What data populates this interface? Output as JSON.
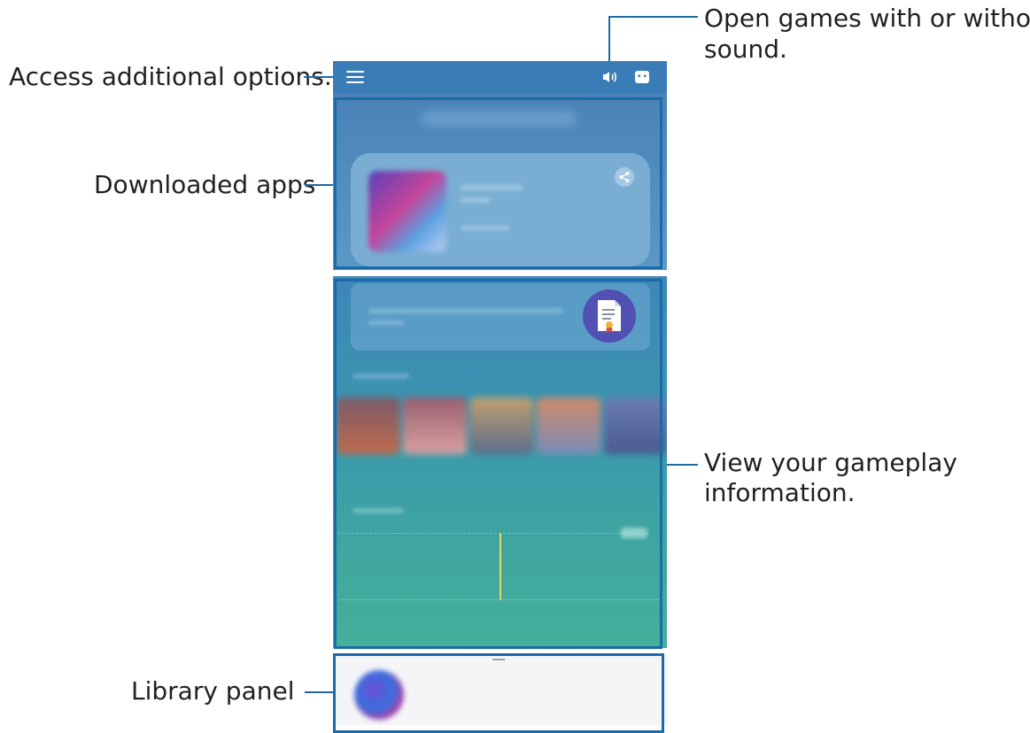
{
  "callouts": {
    "options": "Access additional options.",
    "sound_line1": "Open games with or without",
    "sound_line2": "sound.",
    "downloads": "Downloaded apps",
    "gameplay_line1": "View your gameplay",
    "gameplay_line2": "information.",
    "library": "Library panel"
  },
  "icons": {
    "menu": "hamburger-menu-icon",
    "sound": "speaker-icon",
    "game": "game-controller-icon",
    "share": "share-icon",
    "certificate": "certificate-icon"
  },
  "colors": {
    "callout_line": "#1c6aa8",
    "top_bar": "#3a7cb6",
    "chart_marker": "#e8d664",
    "certificate_badge": "#5151b4"
  }
}
